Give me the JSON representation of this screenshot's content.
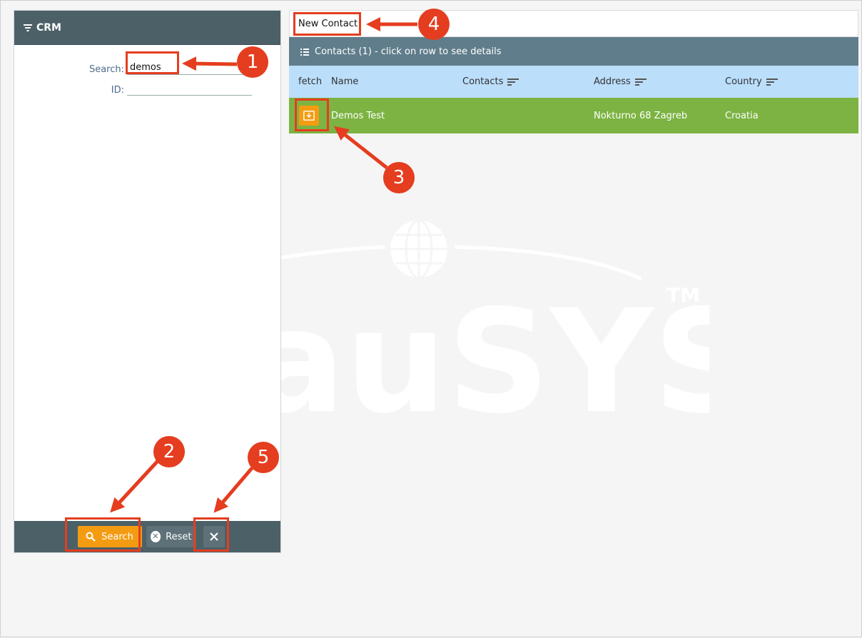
{
  "left_panel": {
    "title": "CRM",
    "search": {
      "label": "Search:",
      "value": "demos",
      "placeholder": ""
    },
    "id": {
      "label": "ID:",
      "value": "",
      "placeholder": ""
    },
    "buttons": {
      "search": "Search",
      "reset": "Reset"
    }
  },
  "toolbar": {
    "new_contact": "New Contact"
  },
  "grid": {
    "title": "Contacts (1) - click on row to see details",
    "columns": [
      "fetch",
      "Name",
      "Contacts",
      "Address",
      "Country"
    ],
    "rows": [
      {
        "name": "Demos Test",
        "contacts": "",
        "address": "Nokturno 68 Zagreb",
        "country": "Croatia"
      }
    ]
  },
  "watermark": {
    "text": "auSYS",
    "tm": "TM"
  },
  "annotations": [
    "1",
    "2",
    "3",
    "4",
    "5"
  ],
  "colors": {
    "header_dark": "#4c6067",
    "grid_title": "#607d8b",
    "grid_head": "#bbdefb",
    "row_selected": "#7cb342",
    "accent_orange": "#f39c12",
    "annotation_red": "#e53d1f"
  },
  "icons": {
    "filter": "filter-icon",
    "search": "search-icon",
    "reset": "reset-icon",
    "close": "close-icon",
    "list": "list-icon",
    "sort": "sort-icon",
    "fetch": "download-icon"
  }
}
